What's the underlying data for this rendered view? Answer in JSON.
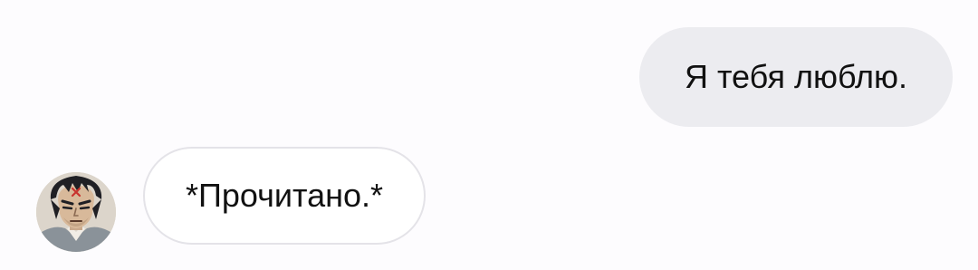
{
  "conversation": {
    "messages": [
      {
        "direction": "outgoing",
        "text": "Я тебя люблю."
      },
      {
        "direction": "incoming",
        "text": "*Прочитано.*"
      }
    ],
    "contact": {
      "avatar_icon": "anime-character-avatar"
    }
  },
  "colors": {
    "background": "#fdfcfe",
    "outgoing_bubble": "#ececf0",
    "incoming_bubble": "#ffffff",
    "incoming_border": "#e4e3e8",
    "text": "#111111"
  }
}
